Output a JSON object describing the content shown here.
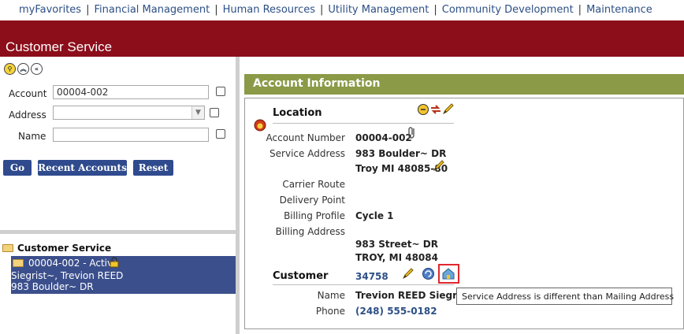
{
  "topnav": {
    "items": [
      "myFavorites",
      "Financial Management",
      "Human Resources",
      "Utility Management",
      "Community Development",
      "Maintenance"
    ],
    "separator": "|"
  },
  "page_title": "Customer Service",
  "search": {
    "account_label": "Account",
    "account_value": "00004-002",
    "address_label": "Address",
    "address_value": "",
    "name_label": "Name",
    "name_value": "",
    "buttons": {
      "go": "Go",
      "recent": "Recent Accounts",
      "reset": "Reset"
    }
  },
  "tree": {
    "root": "Customer Service",
    "selected": {
      "line1": "00004-002 - Active",
      "line2": "Siegrist~, Trevion REED",
      "line3": "983 Boulder~ DR"
    }
  },
  "account_info": {
    "header": "Account Information",
    "location": {
      "title": "Location",
      "account_number_label": "Account Number",
      "account_number": "00004-002",
      "service_address_label": "Service Address",
      "service_address_line1": "983 Boulder~ DR",
      "service_address_line2": "Troy MI 48085-80",
      "carrier_route_label": "Carrier Route",
      "delivery_point_label": "Delivery Point",
      "billing_profile_label": "Billing Profile",
      "billing_profile": "Cycle 1",
      "billing_address_label": "Billing Address",
      "billing_address_line1": "983 Street~ DR",
      "billing_address_line2": "TROY, MI 48084"
    },
    "customer": {
      "title": "Customer",
      "id": "34758",
      "name_label": "Name",
      "name": "Trevion REED Siegrist~",
      "phone_label": "Phone",
      "phone": "(248) 555-0182"
    },
    "tooltip": "Service Address is different than Mailing Address"
  },
  "colors": {
    "nav_text": "#2c4f86",
    "red_band": "#8b0e1a",
    "green_header": "#8a9a47",
    "button_blue": "#2f4a8d",
    "tree_selected": "#3b4f8c",
    "highlight": "#e0282d"
  }
}
